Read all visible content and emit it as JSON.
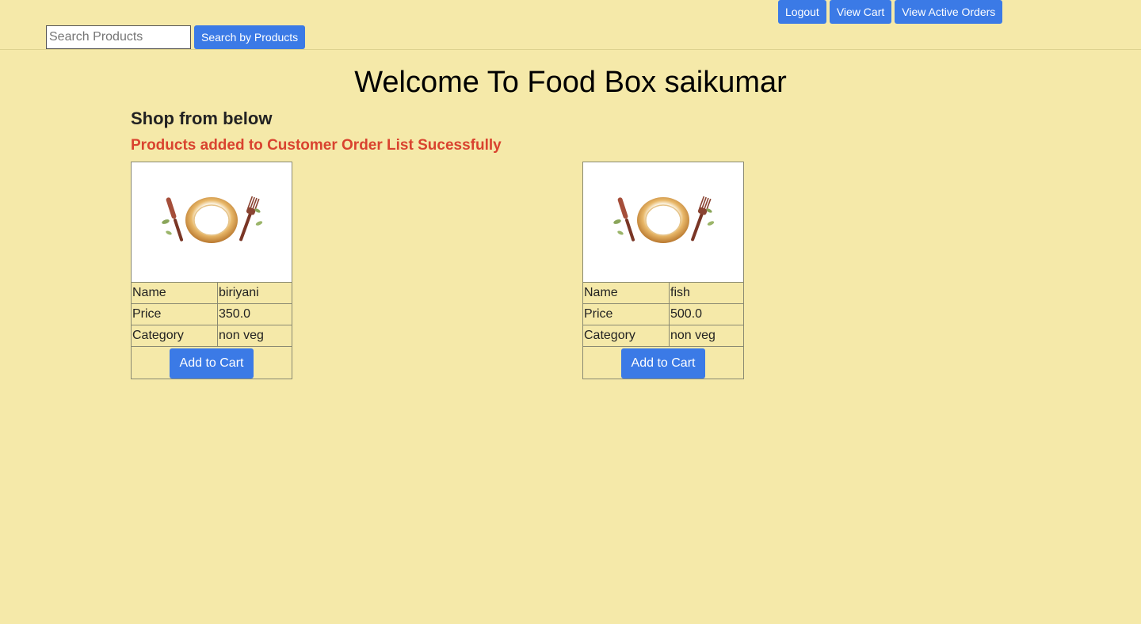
{
  "header": {
    "logout_label": "Logout",
    "view_cart_label": "View Cart",
    "view_active_orders_label": "View Active Orders"
  },
  "search": {
    "placeholder": "Search Products",
    "value": "",
    "button_label": "Search by Products"
  },
  "main": {
    "title": "Welcome To Food Box saikumar",
    "subtitle": "Shop from below",
    "status_message": "Products added to Customer Order List Sucessfully"
  },
  "products": [
    {
      "image_icon": "plate-fork-knife-icon",
      "name_label": "Name",
      "name": "biriyani",
      "price_label": "Price",
      "price": "350.0",
      "category_label": "Category",
      "category": "non veg",
      "add_label": "Add to Cart"
    },
    {
      "image_icon": "plate-fork-knife-icon",
      "name_label": "Name",
      "name": "fish",
      "price_label": "Price",
      "price": "500.0",
      "category_label": "Category",
      "category": "non veg",
      "add_label": "Add to Cart"
    }
  ],
  "colors": {
    "background": "#f5e9a9",
    "button": "#3b7ae6",
    "status": "#d9432f"
  }
}
